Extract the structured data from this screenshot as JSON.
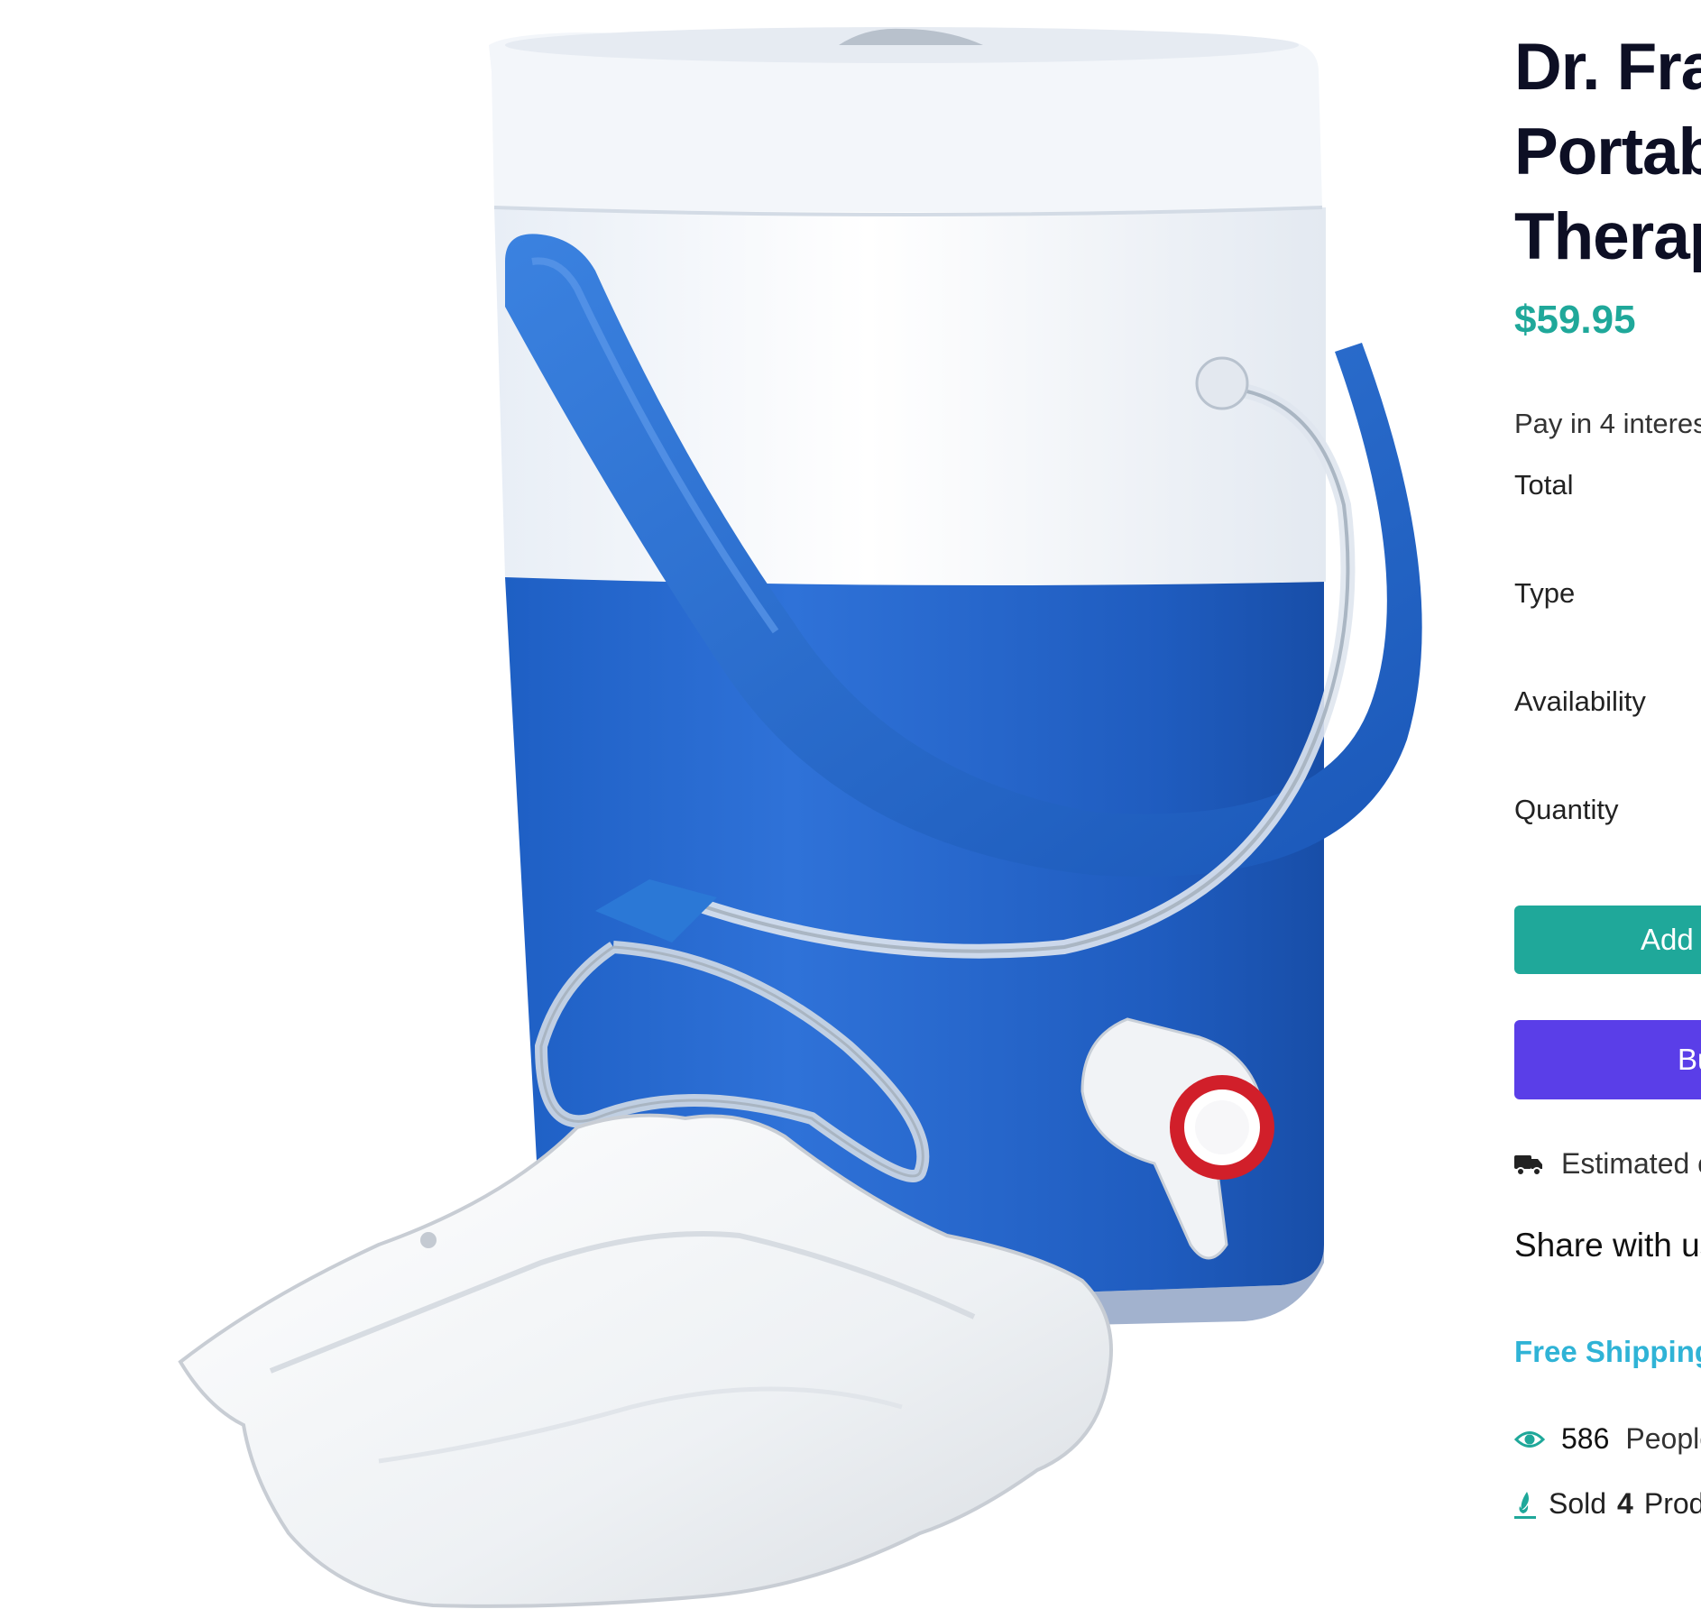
{
  "product": {
    "title_lines": [
      "Dr. Fra",
      "Portab",
      "Therap"
    ],
    "price": "$59.95",
    "installments_text": "Pay in 4 interes",
    "rows": {
      "total": "Total",
      "type": "Type",
      "availability": "Availability",
      "quantity": "Quantity"
    },
    "add_to_cart_label": "Add To C",
    "buy_label": "Bu",
    "delivery_text": "Estimated c",
    "share_text": "Share with us",
    "free_shipping_text": "Free Shipping",
    "viewers": {
      "count": "586",
      "text": "People"
    },
    "sold": {
      "prefix": "Sold",
      "count": "4",
      "suffix": "Prod"
    }
  },
  "image": {
    "description_icon": "product-photo"
  },
  "colors": {
    "title": "#0d0f24",
    "price": "#1fa89a",
    "cart_button": "#1fa89a",
    "buy_button": "#5a3ee8",
    "free_shipping": "#2fb3d6",
    "icon_accent": "#1fa89a"
  }
}
